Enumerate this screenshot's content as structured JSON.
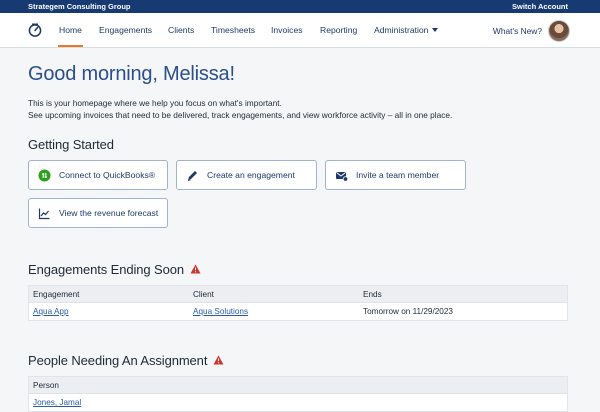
{
  "topbar": {
    "org": "Strategem Consulting Group",
    "switch_account": "Switch Account"
  },
  "nav": {
    "items": [
      "Home",
      "Engagements",
      "Clients",
      "Timesheets",
      "Invoices",
      "Reporting",
      "Administration"
    ],
    "whats_new": "What's New?"
  },
  "greeting": "Good morning, Melissa!",
  "intro": {
    "line1": "This is your homepage where we help you focus on what's important.",
    "line2": "See upcoming invoices that need to be delivered, track engagements, and view workforce activity – all in one place."
  },
  "getting_started": {
    "title": "Getting Started",
    "actions": [
      {
        "label": "Connect to QuickBooks®",
        "icon": "quickbooks-icon"
      },
      {
        "label": "Create an engagement",
        "icon": "pencil-icon"
      },
      {
        "label": "Invite a team member",
        "icon": "mail-icon"
      },
      {
        "label": "View the revenue forecast",
        "icon": "chart-icon"
      }
    ]
  },
  "engagements_ending": {
    "title": "Engagements Ending Soon",
    "columns": [
      "Engagement",
      "Client",
      "Ends"
    ],
    "rows": [
      {
        "engagement": "Aqua App",
        "client": "Aqua Solutions",
        "ends": "Tomorrow on 11/29/2023"
      }
    ]
  },
  "people_needing": {
    "title": "People Needing An Assignment",
    "columns": [
      "Person"
    ],
    "rows": [
      {
        "person": "Jones, Jamal"
      }
    ]
  },
  "colors": {
    "brand": "#173a73",
    "accent": "#e07b2a",
    "warning": "#d0312d",
    "link": "#2a5aa8"
  }
}
